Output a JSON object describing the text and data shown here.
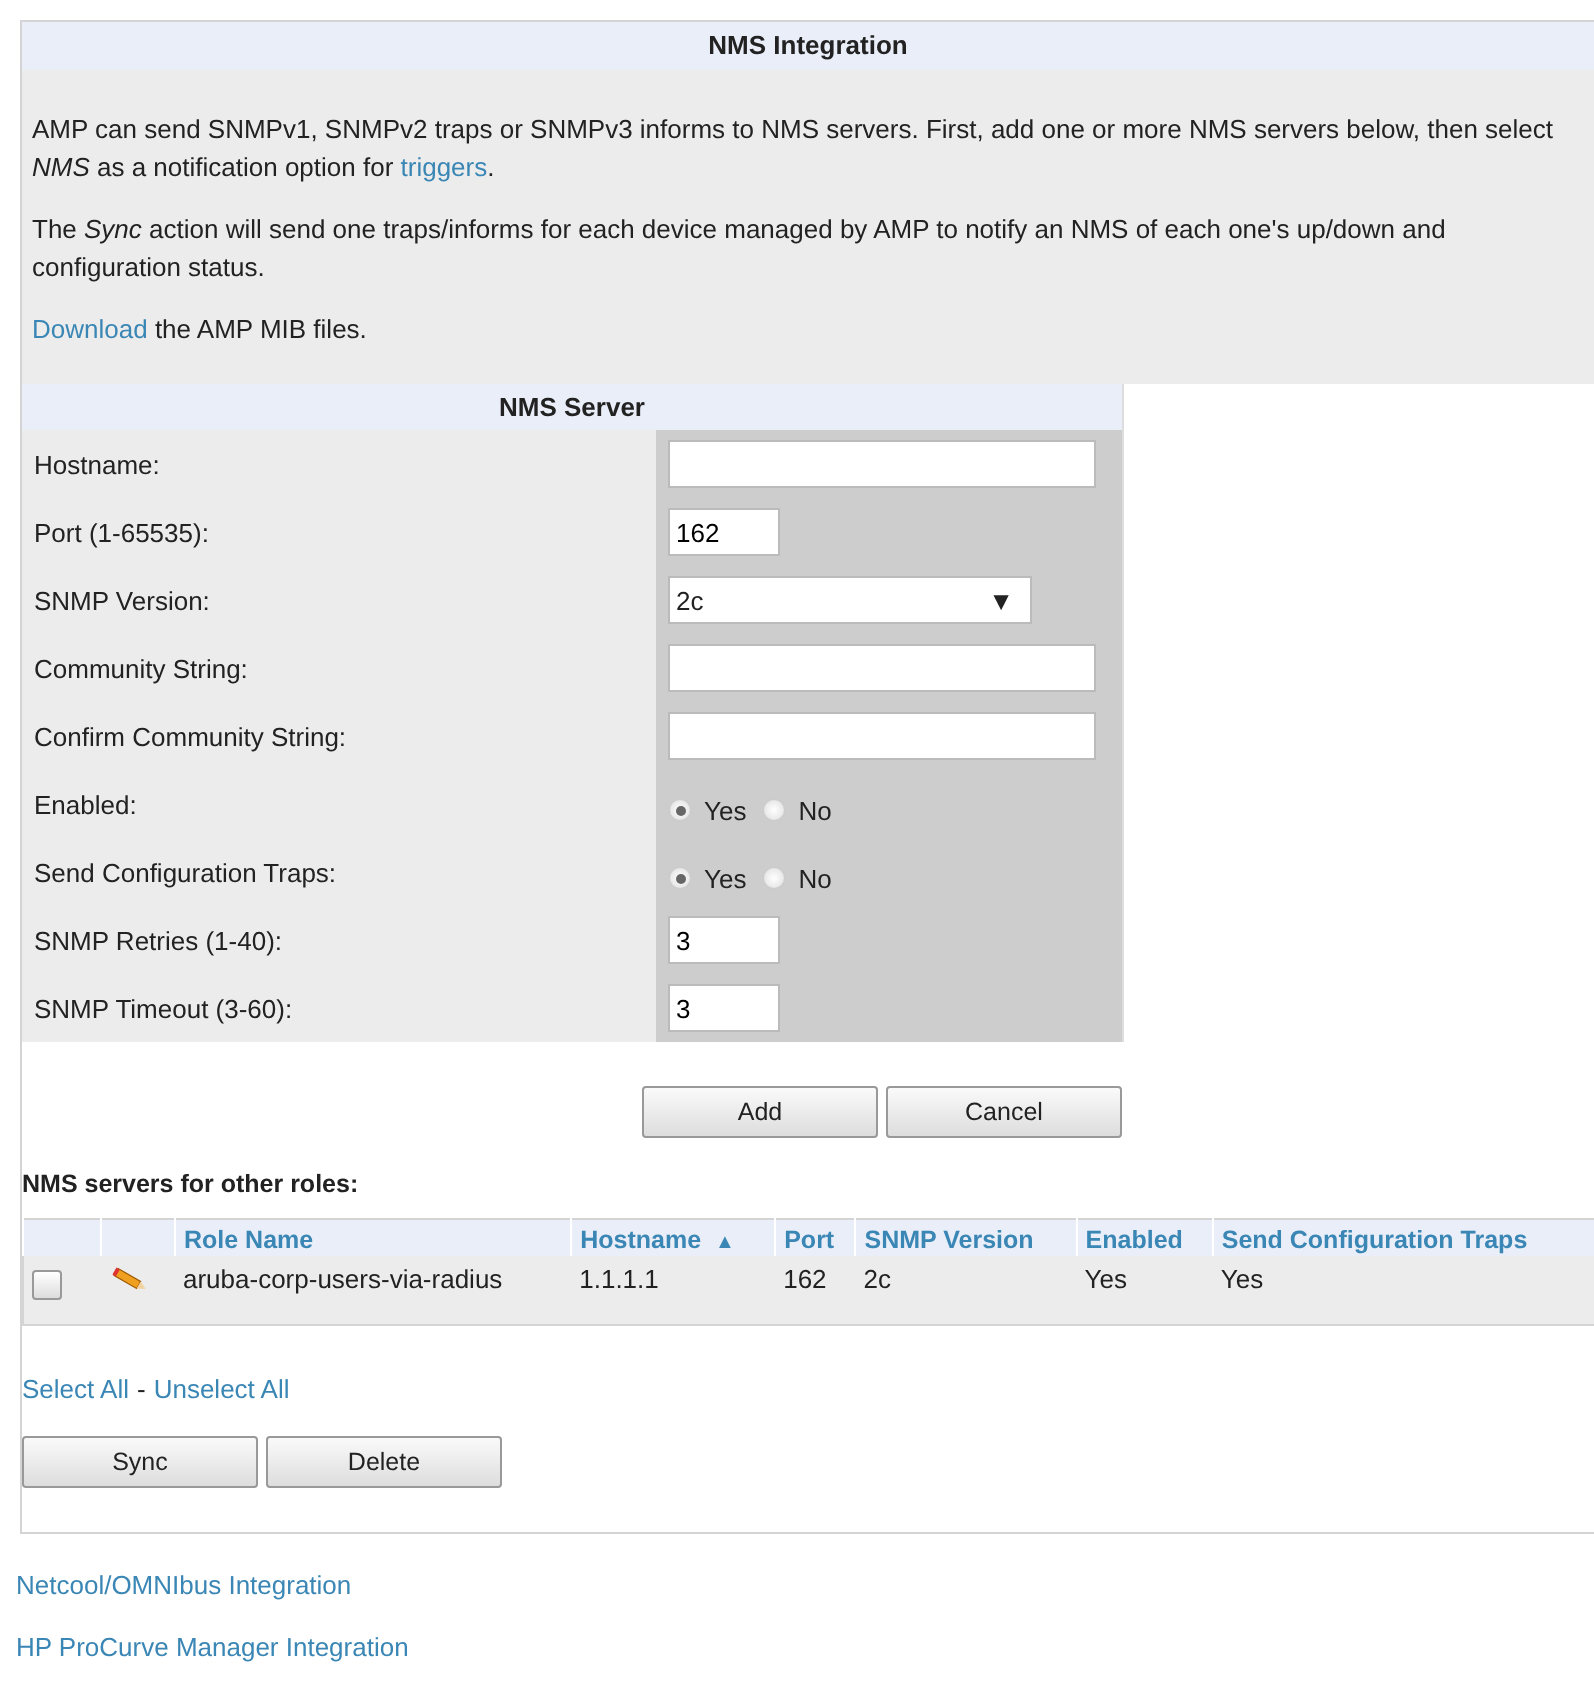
{
  "title": "NMS Integration",
  "intro": [
    {
      "parts": [
        {
          "kind": "text",
          "text": "AMP can send SNMPv1, SNMPv2 traps or SNMPv3 informs to NMS servers. First, add one or more NMS servers below, then select *NMS* as a notification option for "
        },
        {
          "kind": "link",
          "text": "triggers"
        },
        {
          "kind": "text",
          "text": "."
        }
      ]
    },
    {
      "parts": [
        {
          "kind": "text",
          "text": "The *Sync* action will send one traps/informs for each device managed by AMP to notify an NMS of each one's up/down and configuration status."
        }
      ]
    },
    {
      "parts": [
        {
          "kind": "link",
          "text": "Download"
        },
        {
          "kind": "text",
          "text": " the AMP MIB files."
        }
      ]
    }
  ],
  "form": {
    "title": "NMS Server",
    "fields": [
      {
        "kind": "wide_text",
        "label": "Hostname:"
      },
      {
        "kind": "short_text",
        "label": "Port (1-65535):",
        "value": "162"
      },
      {
        "kind": "select",
        "label": "SNMP Version:",
        "value": "2c",
        "arrow": "▼"
      },
      {
        "kind": "wide_text",
        "label": "Community String:"
      },
      {
        "kind": "wide_text",
        "label": "Confirm Community String:"
      },
      {
        "kind": "radio",
        "label": "Enabled:",
        "options": [
          {
            "label": "Yes",
            "selected": true
          },
          {
            "label": "No",
            "selected": false
          }
        ]
      },
      {
        "kind": "radio",
        "label": "Send Configuration Traps:",
        "options": [
          {
            "label": "Yes",
            "selected": true
          },
          {
            "label": "No",
            "selected": false
          }
        ]
      },
      {
        "kind": "short_text",
        "label": "SNMP Retries (1-40):",
        "value": "3"
      },
      {
        "kind": "short_text",
        "label": "SNMP Timeout (3-60):",
        "value": "3"
      }
    ],
    "buttons": [
      "Add",
      "Cancel"
    ]
  },
  "other_roles": {
    "heading": "NMS servers for other roles:",
    "columns": [
      {
        "label": "Role Name"
      },
      {
        "label": "Hostname",
        "sort": "▲"
      },
      {
        "label": "Port"
      },
      {
        "label": "SNMP Version"
      },
      {
        "label": "Enabled"
      },
      {
        "label": "Send Configuration Traps"
      }
    ],
    "rows": [
      {
        "checked": false,
        "cells": [
          "aruba-corp-users-via-radius",
          "1.1.1.1",
          "162",
          "2c",
          "Yes",
          "Yes"
        ]
      }
    ],
    "select_all": "Select All",
    "separator": "-",
    "unselect_all": "Unselect All",
    "buttons": [
      "Sync",
      "Delete"
    ]
  },
  "footer_links": [
    "Netcool/OMNIbus Integration",
    "HP ProCurve Manager Integration"
  ]
}
